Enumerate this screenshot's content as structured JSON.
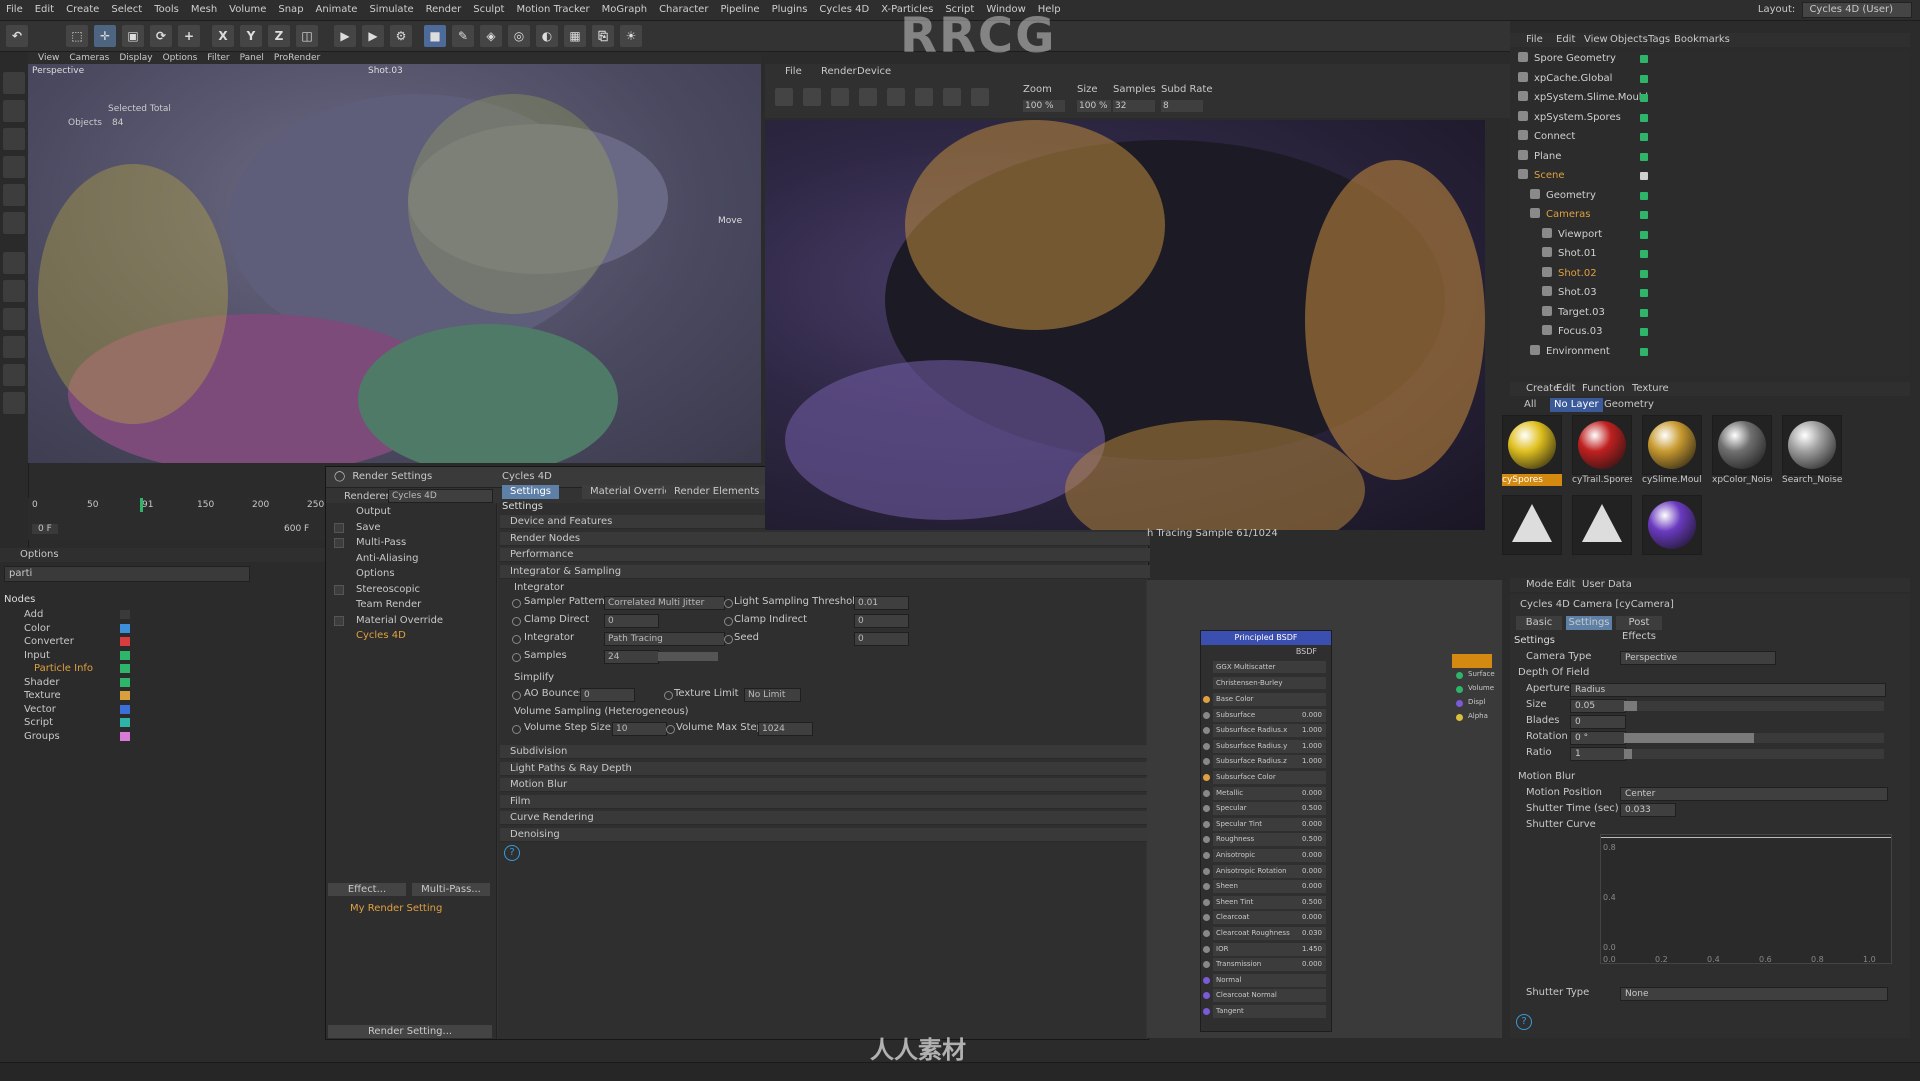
{
  "menubar": {
    "items": [
      "File",
      "Edit",
      "Create",
      "Select",
      "Tools",
      "Mesh",
      "Volume",
      "Snap",
      "Animate",
      "Simulate",
      "Render",
      "Sculpt",
      "Motion Tracker",
      "MoGraph",
      "Character",
      "Pipeline",
      "Plugins",
      "Cycles 4D",
      "X-Particles",
      "Script",
      "Window",
      "Help"
    ],
    "layout_label": "Layout:",
    "layout_value": "Cycles 4D (User)"
  },
  "watermark": {
    "logo": "RRCG",
    "bottom_text": "人人素材"
  },
  "toolbar": {
    "axis_x": "X",
    "axis_y": "Y",
    "axis_z": "Z"
  },
  "viewport": {
    "menu": [
      "View",
      "Cameras",
      "Display",
      "Options",
      "Filter",
      "Panel",
      "ProRender"
    ],
    "label": "Perspective",
    "camera": "Shot.03",
    "selected_total": "Selected Total",
    "objects_label": "Objects",
    "objects_value": "84",
    "move_label": "Move"
  },
  "timeline": {
    "ticks": [
      "0",
      "50",
      "91",
      "150",
      "200",
      "250"
    ],
    "start": "0 F",
    "end": "600 F",
    "current": "0 F"
  },
  "nodes_panel": {
    "options": "Options",
    "search": "parti",
    "title": "Nodes",
    "items": [
      {
        "label": "Add",
        "color": "#3a3a3a"
      },
      {
        "label": "Color",
        "color": "#3c8fd8"
      },
      {
        "label": "Converter",
        "color": "#d83c3c"
      },
      {
        "label": "Input",
        "color": "#2fb56a"
      },
      {
        "label": "Particle Info",
        "color": "#2fb56a"
      },
      {
        "label": "Shader",
        "color": "#2fb56a"
      },
      {
        "label": "Texture",
        "color": "#d8a03c"
      },
      {
        "label": "Vector",
        "color": "#3c6fd8"
      },
      {
        "label": "Script",
        "color": "#2fb5a8"
      },
      {
        "label": "Groups",
        "color": "#d87ad8"
      }
    ]
  },
  "render_settings": {
    "title": "Render Settings",
    "renderer_label": "Renderer",
    "renderer_value": "Cycles 4D",
    "left_items": [
      "Output",
      "Save",
      "Multi-Pass",
      "Anti-Aliasing",
      "Options",
      "Stereoscopic",
      "Team Render",
      "Material Override",
      "Cycles 4D"
    ],
    "effect_btn": "Effect...",
    "multipass_btn": "Multi-Pass...",
    "my_setting": "My Render Setting",
    "render_setting_btn": "Render Setting...",
    "panel_title": "Cycles 4D",
    "tabs": [
      "Settings",
      "Material Override",
      "Render Elements"
    ],
    "settings_label": "Settings",
    "sections": [
      "Device and Features",
      "Render Nodes",
      "Performance",
      "Integrator & Sampling"
    ],
    "integrator_label": "Integrator",
    "sampler_pattern_label": "Sampler Pattern",
    "sampler_pattern_value": "Correlated Multi Jitter",
    "light_threshold_label": "Light Sampling Threshold",
    "light_threshold_value": "0.01",
    "clamp_direct_label": "Clamp Direct",
    "clamp_direct_value": "0",
    "clamp_indirect_label": "Clamp Indirect",
    "clamp_indirect_value": "0",
    "integrator_field_label": "Integrator",
    "integrator_value": "Path Tracing",
    "seed_label": "Seed",
    "seed_value": "0",
    "samples_label": "Samples",
    "samples_value": "24",
    "simplify_label": "Simplify",
    "ao_bounces_label": "AO Bounces",
    "ao_bounces_value": "0",
    "texture_limit_label": "Texture Limit",
    "texture_limit_value": "No Limit",
    "volume_label": "Volume Sampling (Heterogeneous)",
    "volume_step_label": "Volume Step Size",
    "volume_step_value": "10",
    "volume_max_label": "Volume Max Steps",
    "volume_max_value": "1024",
    "more_sections": [
      "Subdivision",
      "Light Paths & Ray Depth",
      "Motion Blur",
      "Film",
      "Curve Rendering",
      "Denoising"
    ],
    "help": "?"
  },
  "picture_viewer": {
    "menu": [
      "File",
      "Render",
      "Device"
    ],
    "zoom_label": "Zoom",
    "zoom_value": "100 %",
    "size_label": "Size",
    "size_value": "100 %",
    "samples_label": "Samples",
    "samples_value": "32",
    "subd_label": "Subd Rate",
    "subd_value": "8",
    "status": "h Tracing Sample 61/1024"
  },
  "bsdf": {
    "title": "Principled BSDF",
    "out": "BSDF",
    "dist1": "GGX Multiscatter",
    "dist2": "Christensen-Burley",
    "rows": [
      {
        "label": "Base Color",
        "value": ""
      },
      {
        "label": "Subsurface",
        "value": "0.000"
      },
      {
        "label": "Subsurface Radius.x",
        "value": "1.000"
      },
      {
        "label": "Subsurface Radius.y",
        "value": "1.000"
      },
      {
        "label": "Subsurface Radius.z",
        "value": "1.000"
      },
      {
        "label": "Subsurface Color",
        "value": ""
      },
      {
        "label": "Metallic",
        "value": "0.000"
      },
      {
        "label": "Specular",
        "value": "0.500"
      },
      {
        "label": "Specular Tint",
        "value": "0.000"
      },
      {
        "label": "Roughness",
        "value": "0.500"
      },
      {
        "label": "Anisotropic",
        "value": "0.000"
      },
      {
        "label": "Anisotropic Rotation",
        "value": "0.000"
      },
      {
        "label": "Sheen",
        "value": "0.000"
      },
      {
        "label": "Sheen Tint",
        "value": "0.500"
      },
      {
        "label": "Clearcoat",
        "value": "0.000"
      },
      {
        "label": "Clearcoat Roughness",
        "value": "0.030"
      },
      {
        "label": "IOR",
        "value": "1.450"
      },
      {
        "label": "Transmission",
        "value": "0.000"
      },
      {
        "label": "Normal",
        "value": ""
      },
      {
        "label": "Clearcoat Normal",
        "value": ""
      },
      {
        "label": "Tangent",
        "value": ""
      }
    ],
    "side_outputs": [
      "Surface",
      "Volume",
      "Displ",
      "Alpha"
    ]
  },
  "object_manager": {
    "menu": [
      "File",
      "Edit",
      "View",
      "Objects",
      "Tags",
      "Bookmarks"
    ],
    "rows": [
      {
        "label": "Spore Geometry",
        "indent": 0,
        "color": "#d0d0d0"
      },
      {
        "label": "xpCache.Global",
        "indent": 0,
        "color": "#d0d0d0"
      },
      {
        "label": "xpSystem.Slime.Mould",
        "indent": 0,
        "color": "#d0d0d0"
      },
      {
        "label": "xpSystem.Spores",
        "indent": 0,
        "color": "#d0d0d0"
      },
      {
        "label": "Connect",
        "indent": 0,
        "color": "#d0d0d0"
      },
      {
        "label": "Plane",
        "indent": 0,
        "color": "#d0d0d0"
      },
      {
        "label": "Scene",
        "indent": 0,
        "color": "#e0a040"
      },
      {
        "label": "Geometry",
        "indent": 1,
        "color": "#d0d0d0"
      },
      {
        "label": "Cameras",
        "indent": 1,
        "color": "#e0a040"
      },
      {
        "label": "Viewport",
        "indent": 2,
        "color": "#d0d0d0"
      },
      {
        "label": "Shot.01",
        "indent": 2,
        "color": "#d0d0d0"
      },
      {
        "label": "Shot.02",
        "indent": 2,
        "color": "#e0a040"
      },
      {
        "label": "Shot.03",
        "indent": 2,
        "color": "#d0d0d0"
      },
      {
        "label": "Target.03",
        "indent": 2,
        "color": "#d0d0d0"
      },
      {
        "label": "Focus.03",
        "indent": 2,
        "color": "#d0d0d0"
      },
      {
        "label": "Environment",
        "indent": 1,
        "color": "#d0d0d0"
      }
    ]
  },
  "material_manager": {
    "menu": [
      "Create",
      "Edit",
      "Function",
      "Texture"
    ],
    "tabs": [
      "All",
      "No Layer",
      "Geometry"
    ],
    "materials": [
      {
        "label": "cySpores",
        "color": "#e0c020",
        "selected": true
      },
      {
        "label": "cyTrail.Spores",
        "color": "#c02020",
        "selected": false
      },
      {
        "label": "cySlime.Mould",
        "color": "#c89a30",
        "selected": false
      },
      {
        "label": "xpColor_Noise",
        "color": "#707070",
        "selected": false
      },
      {
        "label": "Search_Noise",
        "color": "#a0a0a0",
        "selected": false
      },
      {
        "label": "",
        "color": "#111111",
        "selected": false
      },
      {
        "label": "",
        "color": "#111111",
        "selected": false
      },
      {
        "label": "",
        "color": "#6a3ac0",
        "selected": false
      }
    ]
  },
  "attributes": {
    "menu": [
      "Mode",
      "Edit",
      "User Data"
    ],
    "title": "Cycles 4D Camera [cyCamera]",
    "tabs": [
      "Basic",
      "Settings",
      "Post Effects"
    ],
    "settings_label": "Settings",
    "camera_type_label": "Camera Type",
    "camera_type_value": "Perspective",
    "dof_label": "Depth Of Field",
    "aperture_label": "Aperture",
    "aperture_value": "Radius",
    "size_label": "Size",
    "size_value": "0.05",
    "size_level": 0.05,
    "blades_label": "Blades",
    "blades_value": "0",
    "rotation_label": "Rotation",
    "rotation_value": "0 °",
    "rotation_level": 0.5,
    "ratio_label": "Ratio",
    "ratio_value": "1",
    "ratio_level": 0.03,
    "motion_blur_label": "Motion Blur",
    "motion_position_label": "Motion Position",
    "motion_position_value": "Center",
    "shutter_time_label": "Shutter Time (sec)",
    "shutter_time_value": "0.033",
    "shutter_curve_label": "Shutter Curve",
    "curve_x_ticks": [
      "0.0",
      "0.2",
      "0.4",
      "0.6",
      "0.8",
      "1.0"
    ],
    "curve_y_ticks": [
      "0.8",
      "0.4",
      "0.0"
    ],
    "shutter_type_label": "Shutter Type",
    "shutter_type_value": "None",
    "help": "?"
  }
}
